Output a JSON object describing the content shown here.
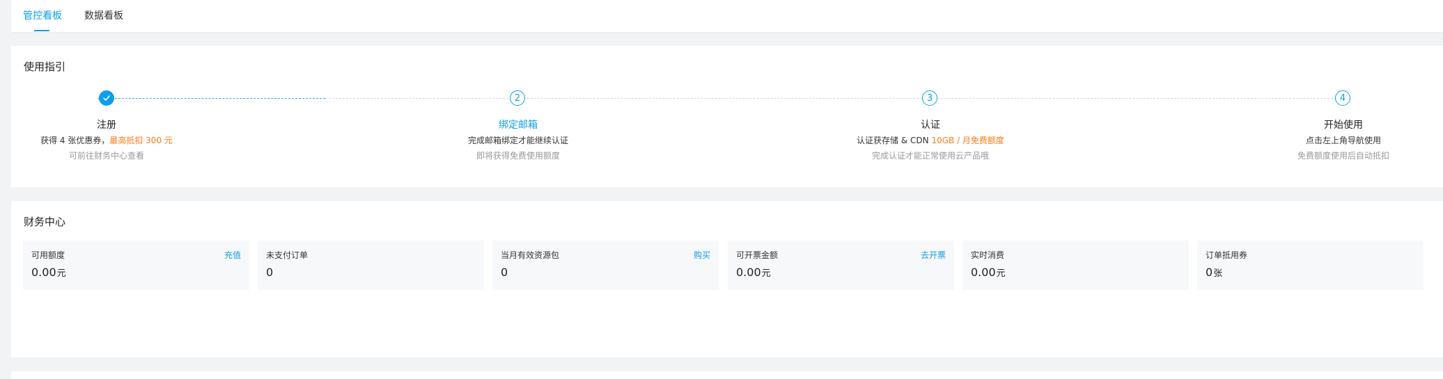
{
  "tabs": [
    {
      "label": "管控看板",
      "active": true
    },
    {
      "label": "数据看板",
      "active": false
    }
  ],
  "guide": {
    "title": "使用指引",
    "steps": [
      {
        "status": "done",
        "title": "注册",
        "desc": "获得 4 张优惠券，",
        "desc_highlight": "最高抵扣 300 元",
        "note": "可前往财务中心查看"
      },
      {
        "status": "current",
        "number": "2",
        "title": "绑定邮箱",
        "desc": "完成邮箱绑定才能继续认证",
        "desc_highlight": "",
        "note": "即将获得免费使用额度"
      },
      {
        "status": "todo",
        "number": "3",
        "title": "认证",
        "desc": "认证获存储 & CDN ",
        "desc_highlight": "10GB / 月免费额度",
        "note": "完成认证才能正常使用云产品哦"
      },
      {
        "status": "todo",
        "number": "4",
        "title": "开始使用",
        "desc": "点击左上角导航使用",
        "desc_highlight": "",
        "note": "免费额度使用后自动抵扣"
      }
    ]
  },
  "finance": {
    "title": "财务中心",
    "items": [
      {
        "label": "可用额度",
        "action": "充值",
        "value": "0.00",
        "unit": "元"
      },
      {
        "label": "未支付订单",
        "action": "",
        "value": "0",
        "unit": ""
      },
      {
        "label": "当月有效资源包",
        "action": "购买",
        "value": "0",
        "unit": ""
      },
      {
        "label": "可开票金额",
        "action": "去开票",
        "value": "0.00",
        "unit": "元"
      },
      {
        "label": "实时消费",
        "action": "",
        "value": "0.00",
        "unit": "元"
      },
      {
        "label": "订单抵用券",
        "action": "",
        "value": "0",
        "unit": "张"
      }
    ]
  },
  "colors": {
    "accent": "#0a9ff0",
    "highlight": "#ff7a1a"
  },
  "icons": {
    "done_step": "check-icon"
  }
}
